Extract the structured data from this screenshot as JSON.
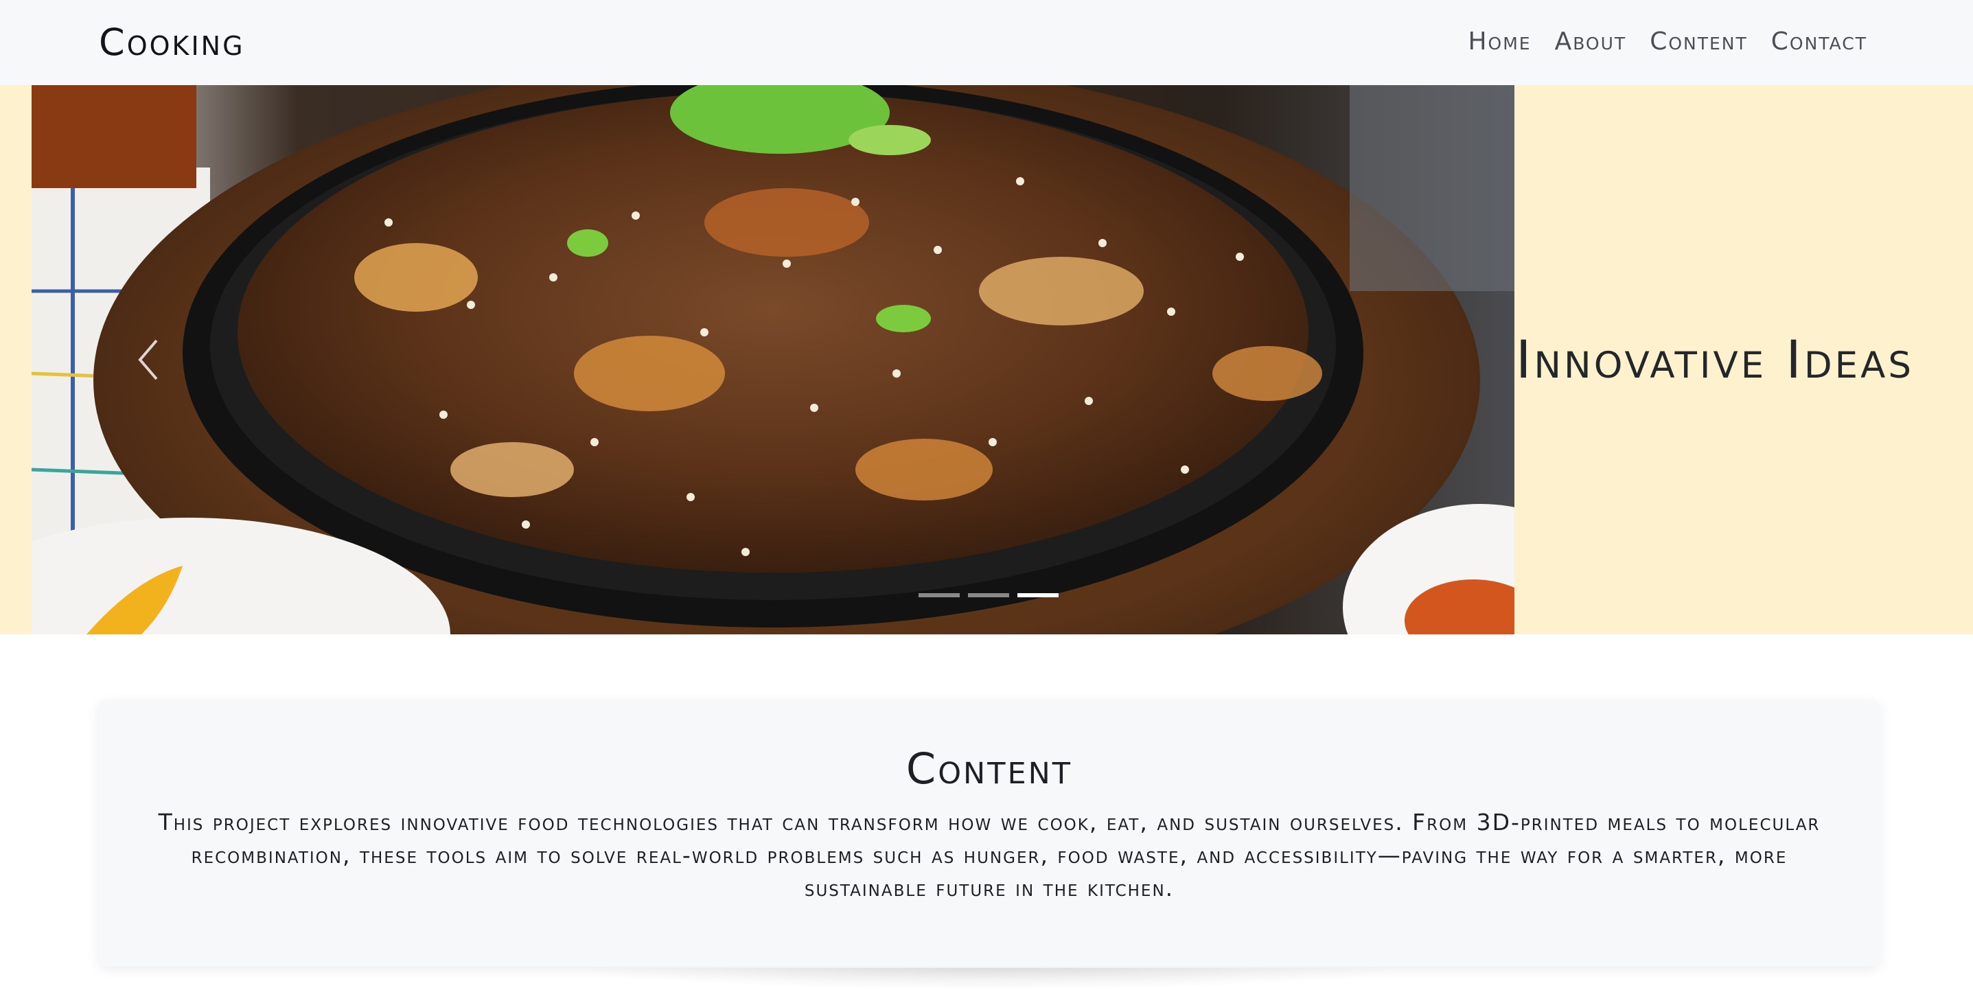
{
  "navbar": {
    "brand": "Cooking",
    "links": [
      "Home",
      "About",
      "Content",
      "Contact"
    ]
  },
  "carousel": {
    "caption": "Innovative Ideas",
    "slide_count": 3,
    "active_slide": 3,
    "prev_icon": "chevron-left-icon",
    "background_color": "#fdf2cd"
  },
  "content": {
    "title": "Content",
    "text": "This project explores innovative food technologies that can transform how we cook, eat, and sustain ourselves. From 3D-printed meals to molecular recombination, these tools aim to solve real-world problems such as hunger, food waste, and accessibility—paving the way for a smarter, more sustainable future in the kitchen."
  }
}
